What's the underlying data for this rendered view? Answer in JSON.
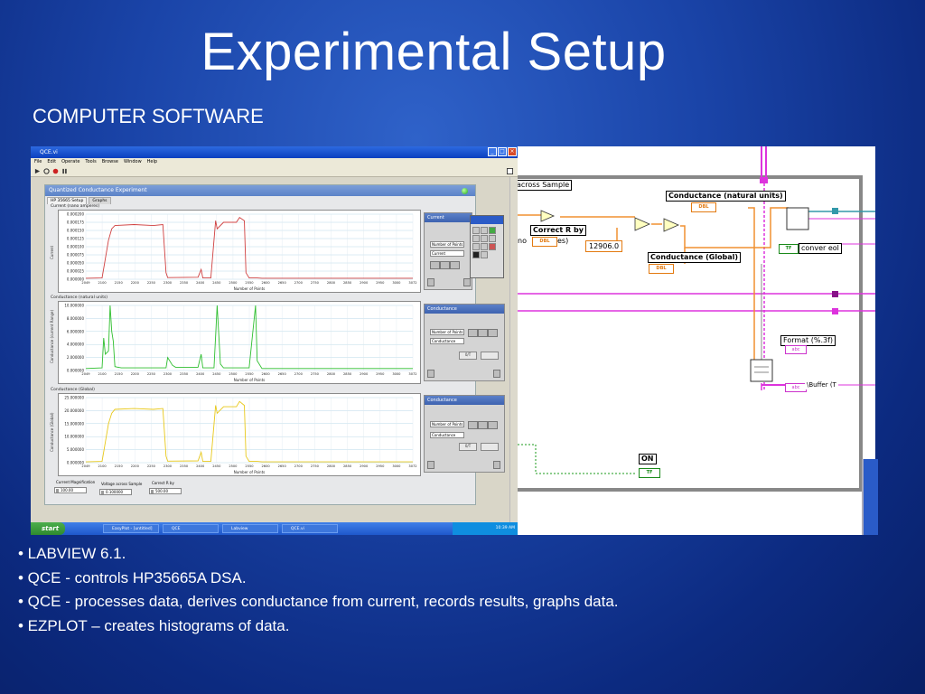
{
  "slide": {
    "title": "Experimental Setup",
    "subtitle": "COMPUTER SOFTWARE",
    "bullets": [
      "• LABVIEW 6.1.",
      "• QCE - controls HP35665A DSA.",
      "• QCE - processes data, derives conductance from current, records results, graphs data.",
      "• EZPLOT – creates histograms of data."
    ]
  },
  "front_panel": {
    "window_title": "QCE.vi",
    "menu": [
      "File",
      "Edit",
      "Operate",
      "Tools",
      "Browse",
      "Window",
      "Help"
    ],
    "panel_title": "Quantized Conductance Experiment",
    "tabs": [
      "HP 35665 Setup",
      "Graphs"
    ],
    "x_axis_title": "Number of Points",
    "x_ticks": [
      "2049",
      "2100",
      "2150",
      "2200",
      "2250",
      "2300",
      "2350",
      "2400",
      "2450",
      "2500",
      "2550",
      "2600",
      "2650",
      "2700",
      "2750",
      "2800",
      "2850",
      "2900",
      "2950",
      "3000",
      "3072"
    ],
    "graphs": [
      {
        "title": "Current (nano amperes)",
        "ylabel": "Current",
        "y_ticks": [
          "0.000200",
          "0.000175",
          "0.000150",
          "0.000125",
          "0.000100",
          "0.000075",
          "0.000050",
          "0.000025",
          "0.000000"
        ],
        "legend_title": "Current",
        "legend_fields": [
          "Number of Points",
          "Current"
        ],
        "color": "#d04040"
      },
      {
        "title": "Conductance (natural units)",
        "ylabel": "Conductance (current Range)",
        "y_ticks": [
          "10.000000",
          "8.000000",
          "6.000000",
          "4.000000",
          "2.000000",
          "0.000000"
        ],
        "legend_title": "Conductance",
        "legend_fields": [
          "Number of Points",
          "Conductance"
        ],
        "color": "#2fbf2f"
      },
      {
        "title": "Conductance (Global)",
        "ylabel": "Conductance (Global)",
        "y_ticks": [
          "25.000000",
          "20.000000",
          "15.000000",
          "10.000000",
          "5.000000",
          "0.000000"
        ],
        "legend_title": "Conductance",
        "legend_fields": [
          "Number of Points",
          "Conductance"
        ],
        "color": "#e8c81a"
      }
    ],
    "controls": [
      {
        "label": "Current Magnification",
        "value": "100.00"
      },
      {
        "label": "Voltage across Sample",
        "value": "0.100000"
      },
      {
        "label": "Correct R by",
        "value": "500.00"
      }
    ],
    "taskbar": {
      "start": "start",
      "items": [
        "EasyPlot - [untitled]",
        "QCE",
        "Labview",
        "QCE.vi"
      ],
      "clock": "10:39 AM"
    }
  },
  "block_diagram": {
    "labels": {
      "across_sample": "across Sample",
      "conductance_natural": "Conductance (natural units)",
      "correct_r": "Correct R by",
      "no_es": "no",
      "no_es_tail": "es)",
      "constant": "12906.0",
      "conductance_global": "Conductance (Global)",
      "format": "Format (%.3f)",
      "conver_eol": "conver eol",
      "on": "ON",
      "buffer": "\\Buffer (T"
    },
    "terminals": {
      "dbl": "DBL",
      "bool": "TF",
      "str": "abc"
    },
    "colors": {
      "numeric_wire": "#f09030",
      "string_wire": "#dd33dd",
      "boolean_wire": "#1a9a1a",
      "loop_border": "#888888"
    }
  },
  "chart_data": [
    {
      "type": "line",
      "title": "Current (nano amperes)",
      "xlabel": "Number of Points",
      "ylabel": "Current",
      "xlim": [
        2049,
        3072
      ],
      "ylim": [
        0,
        0.0002
      ],
      "series": [
        {
          "x": [
            2049,
            2100,
            2120,
            2130,
            2140,
            2200,
            2260,
            2290,
            2300,
            2305,
            2400,
            2410,
            2415,
            2440,
            2455,
            2460,
            2480,
            2500,
            2520,
            2530,
            2545,
            2550,
            2560,
            2585,
            2600,
            3072
          ],
          "y": [
            3e-06,
            4e-06,
            0.00012,
            0.000155,
            0.000165,
            0.000168,
            0.000165,
            0.000168,
            2e-05,
            5e-06,
            6e-06,
            3e-05,
            4e-06,
            4e-06,
            0.00018,
            0.000155,
            0.000175,
            0.000175,
            0.000175,
            0.00019,
            0.00018,
            2e-05,
            4e-06,
            4e-06,
            3e-06,
            3e-06
          ]
        }
      ]
    },
    {
      "type": "line",
      "title": "Conductance (natural units)",
      "xlabel": "Number of Points",
      "ylabel": "Conductance (current Range)",
      "xlim": [
        2049,
        3072
      ],
      "ylim": [
        0,
        10
      ],
      "series": [
        {
          "x": [
            2049,
            2100,
            2105,
            2110,
            2120,
            2125,
            2130,
            2135,
            2140,
            2150,
            2160,
            2170,
            2200,
            2250,
            2300,
            2305,
            2320,
            2330,
            2400,
            2410,
            2415,
            2450,
            2460,
            2470,
            2480,
            2560,
            2580,
            2585,
            2600,
            2700,
            2800,
            2900,
            3072
          ],
          "y": [
            0.3,
            0.4,
            5.0,
            2.5,
            3.0,
            10.0,
            6.0,
            4.5,
            0.6,
            0.5,
            0.4,
            0.4,
            0.4,
            0.4,
            0.4,
            2.0,
            0.8,
            0.5,
            0.5,
            2.5,
            0.4,
            0.4,
            10.0,
            1.0,
            0.4,
            0.4,
            10.0,
            1.5,
            0.3,
            0.3,
            0.3,
            0.3,
            0.3
          ]
        }
      ]
    },
    {
      "type": "line",
      "title": "Conductance (Global)",
      "xlabel": "Number of Points",
      "ylabel": "Conductance (Global)",
      "xlim": [
        2049,
        3072
      ],
      "ylim": [
        0,
        25
      ],
      "series": [
        {
          "x": [
            2049,
            2100,
            2120,
            2130,
            2140,
            2200,
            2260,
            2290,
            2300,
            2305,
            2400,
            2410,
            2415,
            2440,
            2455,
            2460,
            2480,
            2500,
            2520,
            2530,
            2545,
            2550,
            2560,
            2585,
            2600,
            3072
          ],
          "y": [
            0.3,
            0.5,
            15.0,
            19.0,
            20.5,
            20.8,
            20.5,
            20.8,
            2.5,
            0.6,
            0.7,
            4.0,
            0.5,
            0.5,
            22.0,
            19.0,
            21.5,
            21.5,
            21.5,
            23.5,
            22.0,
            2.5,
            0.5,
            0.5,
            0.3,
            0.3
          ]
        }
      ]
    }
  ]
}
